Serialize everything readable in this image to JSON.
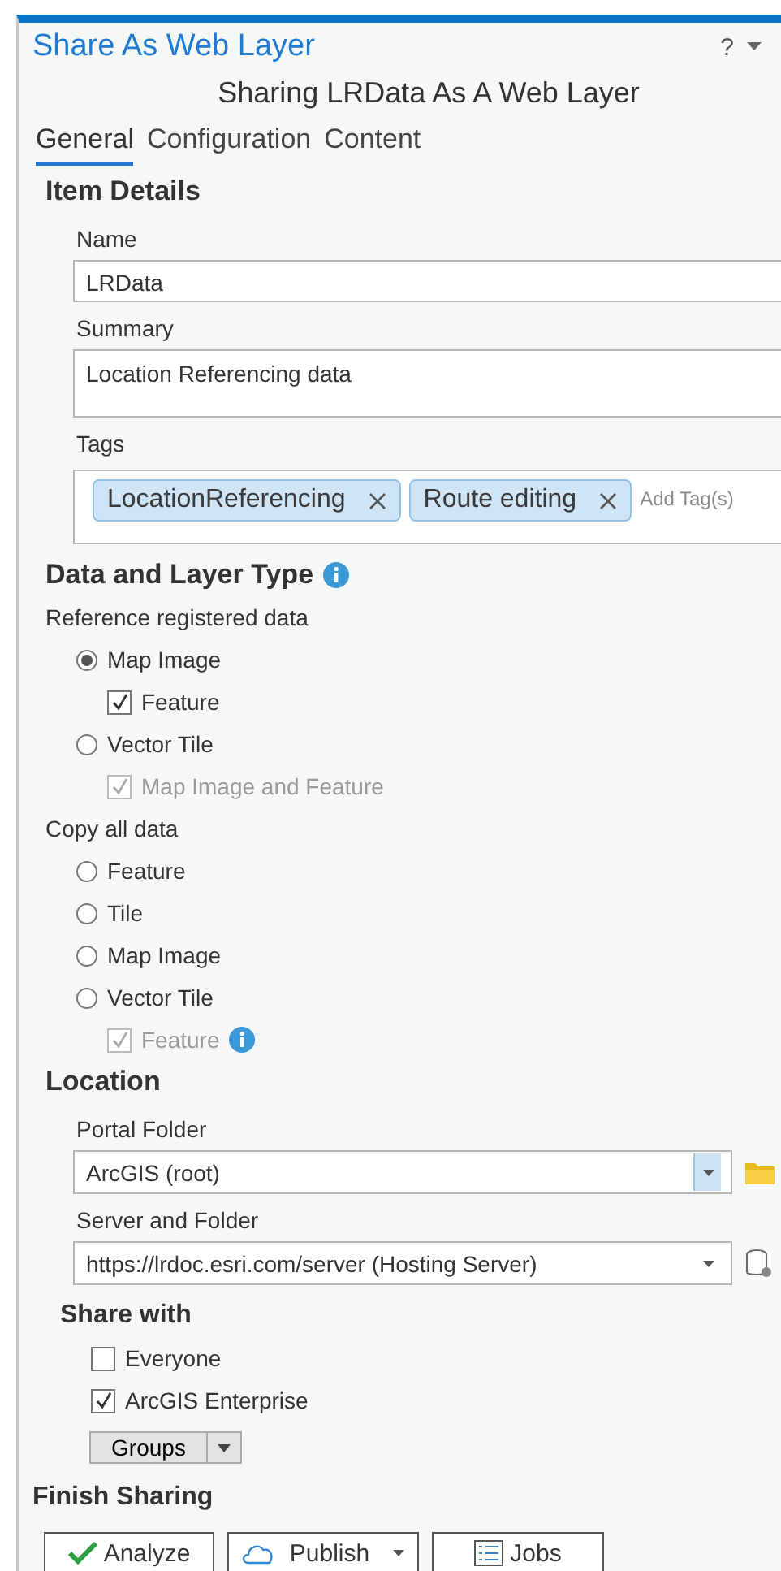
{
  "window": {
    "title": "Share As Web Layer",
    "help": "?"
  },
  "subtitle": "Sharing LRData As A Web Layer",
  "tabs": [
    {
      "label": "General",
      "selected": true
    },
    {
      "label": "Configuration",
      "selected": false
    },
    {
      "label": "Content",
      "selected": false
    }
  ],
  "item_details": {
    "heading": "Item Details",
    "fields": [
      {
        "label": "Name",
        "value": "LRData",
        "kind": "line"
      },
      {
        "label": "Summary",
        "value": "Location Referencing data",
        "kind": "area"
      }
    ],
    "tags": {
      "label": "Tags",
      "chips": [
        "LocationReferencing",
        "Route editing"
      ],
      "placeholder": "Add Tag(s)"
    }
  },
  "data_layer_type": {
    "heading": "Data and Layer Type",
    "groups": [
      {
        "label": "Reference registered data",
        "options": [
          {
            "label": "Map Image",
            "selected": true,
            "children": [
              {
                "label": "Feature",
                "checked": true,
                "disabled": false
              }
            ]
          },
          {
            "label": "Vector Tile",
            "selected": false,
            "children": [
              {
                "label": "Map Image and Feature",
                "checked": true,
                "disabled": true
              }
            ]
          }
        ]
      },
      {
        "label": "Copy all data",
        "options": [
          {
            "label": "Feature",
            "selected": false
          },
          {
            "label": "Tile",
            "selected": false
          },
          {
            "label": "Map Image",
            "selected": false
          },
          {
            "label": "Vector Tile",
            "selected": false,
            "children": [
              {
                "label": "Feature",
                "checked": true,
                "disabled": true,
                "info": true
              }
            ]
          }
        ]
      }
    ]
  },
  "location": {
    "heading": "Location",
    "dropdowns": [
      {
        "label": "Portal Folder",
        "value": "ArcGIS (root)",
        "kind": "folder"
      },
      {
        "label": "Server and Folder",
        "value": "https://lrdoc.esri.com/server (Hosting Server)",
        "kind": "server"
      }
    ]
  },
  "share_with": {
    "heading": "Share with",
    "options": [
      {
        "label": "Everyone",
        "checked": false
      },
      {
        "label": "ArcGIS Enterprise",
        "checked": true
      }
    ],
    "groups_button": "Groups"
  },
  "finish": {
    "heading": "Finish Sharing",
    "buttons": [
      {
        "label": "Analyze",
        "kind": "analyze"
      },
      {
        "label": "Publish",
        "kind": "publish"
      },
      {
        "label": "Jobs",
        "kind": "jobs"
      }
    ]
  }
}
